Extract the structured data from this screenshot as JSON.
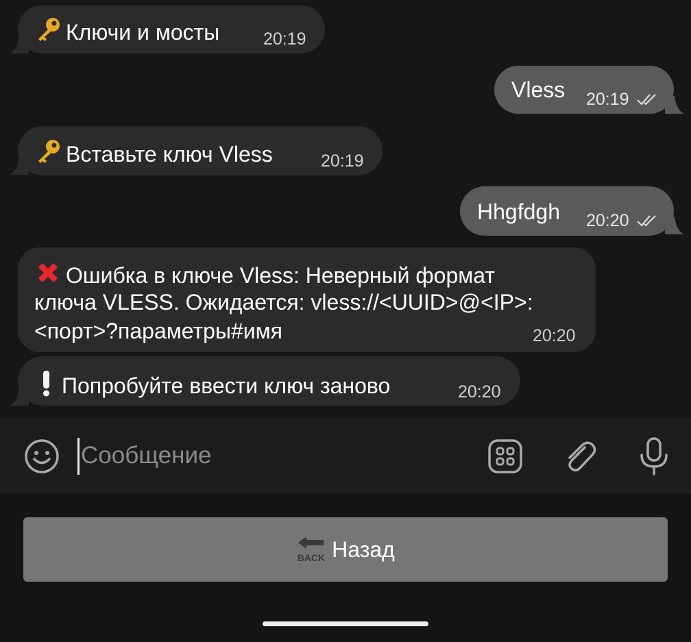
{
  "messages": [
    {
      "direction": "in",
      "emoji": "key-emoji",
      "text": "Ключи и мосты",
      "time": "20:19"
    },
    {
      "direction": "out",
      "text": "Vless",
      "time": "20:19",
      "status": "read"
    },
    {
      "direction": "in",
      "emoji": "key-emoji",
      "text": "Вставьте ключ Vless",
      "time": "20:19"
    },
    {
      "direction": "out",
      "text": "Hhgfdgh",
      "time": "20:20",
      "status": "read"
    },
    {
      "direction": "in",
      "emoji": "cross-mark-emoji",
      "line1": "Ошибка в ключе Vless: Неверный формат",
      "line2": "ключа VLESS. Ожидается: vless://<UUID>@<IP>:",
      "line3": "<порт>?параметры#имя",
      "time": "20:20"
    },
    {
      "direction": "in",
      "emoji": "exclamation-emoji",
      "text": "Попробуйте ввести ключ заново",
      "time": "20:20"
    }
  ],
  "composer": {
    "placeholder": "Сообщение",
    "icons": [
      "emoji-icon",
      "bot-menu-icon",
      "attach-icon",
      "microphone-icon"
    ]
  },
  "keyboard": {
    "button_badge": "BACK",
    "button_label": "Назад"
  },
  "colors": {
    "background": "#161616",
    "incoming_bubble": "#2b2b2b",
    "outgoing_bubble": "#5a5a5a",
    "keyboard_button": "#767676",
    "error_red": "#e8262d",
    "key_gold": "#e6a92a"
  }
}
